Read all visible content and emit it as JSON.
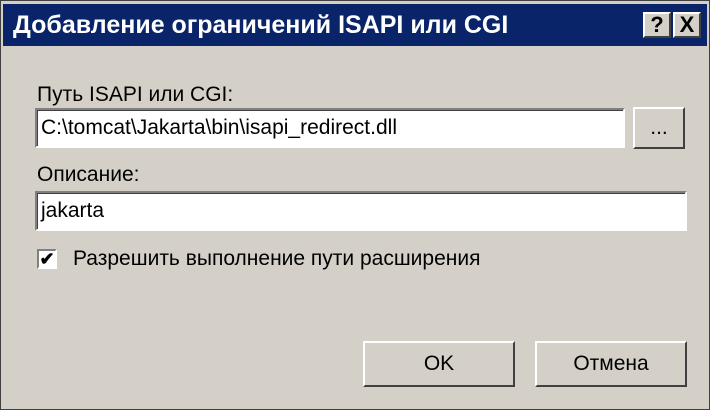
{
  "window": {
    "title": "Добавление ограничений ISAPI или CGI",
    "help_label": "?",
    "close_label": "X"
  },
  "path": {
    "label": "Путь ISAPI или CGI:",
    "value": "C:\\tomcat\\Jakarta\\bin\\isapi_redirect.dll",
    "browse_label": "..."
  },
  "description": {
    "label": "Описание:",
    "value": "jakarta"
  },
  "allow_execution": {
    "label": "Разрешить выполнение пути расширения",
    "checked": true,
    "check_glyph": "✔"
  },
  "buttons": {
    "ok_label": "OK",
    "cancel_label": "Отмена"
  }
}
